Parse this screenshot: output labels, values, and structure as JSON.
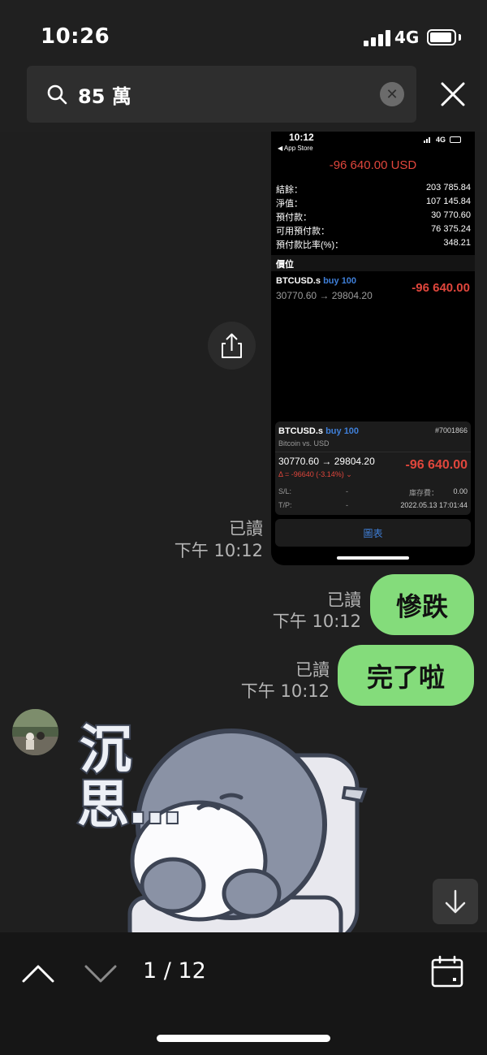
{
  "status_bar": {
    "time": "10:26",
    "network": "4G"
  },
  "search": {
    "query": "85 萬"
  },
  "screenshot": {
    "time": "10:12",
    "back_app": "◀ App Store",
    "network": "4G",
    "total_pnl": "-96 640.00 USD",
    "account": [
      {
        "label": "結餘：",
        "value": "203 785.84"
      },
      {
        "label": "淨值：",
        "value": "107 145.84"
      },
      {
        "label": "預付款：",
        "value": "30 770.60"
      },
      {
        "label": "可用預付款：",
        "value": "76 375.24"
      },
      {
        "label": "預付款比率(%)：",
        "value": "348.21"
      }
    ],
    "positions_header": "價位",
    "position": {
      "symbol": "BTCUSD.s",
      "side": "buy 100",
      "prices": "30770.60 → 29804.20",
      "pnl": "-96 640.00"
    },
    "detail": {
      "symbol": "BTCUSD.s",
      "side": "buy 100",
      "ticket": "#7001866",
      "description": "Bitcoin vs. USD",
      "prices": "30770.60 → 29804.20",
      "pnl": "-96 640.00",
      "delta": "Δ = -96640 (-3.14%) ⌄",
      "sl_label": "S/L:",
      "sl_value": "-",
      "swap_label": "庫存費：",
      "swap_value": "0.00",
      "tp_label": "T/P:",
      "tp_value": "-",
      "datetime": "2022.05.13 17:01:44"
    },
    "chart_button": "圖表"
  },
  "messages": [
    {
      "read": "已讀",
      "time": "下午 10:12"
    },
    {
      "read": "已讀",
      "time": "下午 10:12",
      "text": "慘跌"
    },
    {
      "read": "已讀",
      "time": "下午 10:12",
      "text": "完了啦"
    }
  ],
  "sticker": {
    "text": "沉思…"
  },
  "footer": {
    "counter": "1 / 12"
  },
  "colors": {
    "bubble": "#84dc7b",
    "loss_red": "#e0463c",
    "link_blue": "#3f7fd8"
  }
}
